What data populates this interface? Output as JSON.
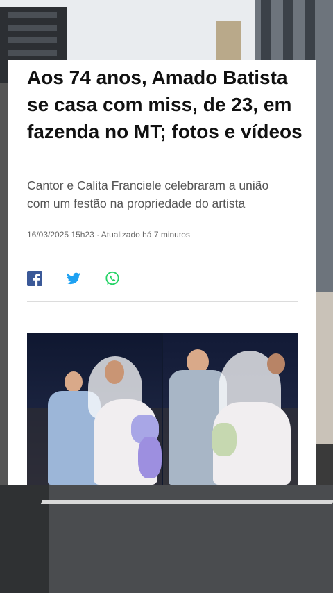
{
  "article": {
    "title": "Aos 74 anos, Amado Batista se casa com miss, de 23, em fazenda no MT; fotos e vídeos",
    "subtitle": "Cantor e Calita Franciele celebraram a união com um festão na propriedade do artista",
    "date": "16/03/2025 15h23",
    "separator": "·",
    "updated": "Atualizado há 7 minutos"
  },
  "share": {
    "icons": [
      "facebook-icon",
      "twitter-icon",
      "whatsapp-icon"
    ]
  },
  "colors": {
    "facebook": "#3b5998",
    "twitter": "#1da1f2",
    "whatsapp": "#25d366",
    "title": "#111111",
    "subtitle": "#555555"
  }
}
